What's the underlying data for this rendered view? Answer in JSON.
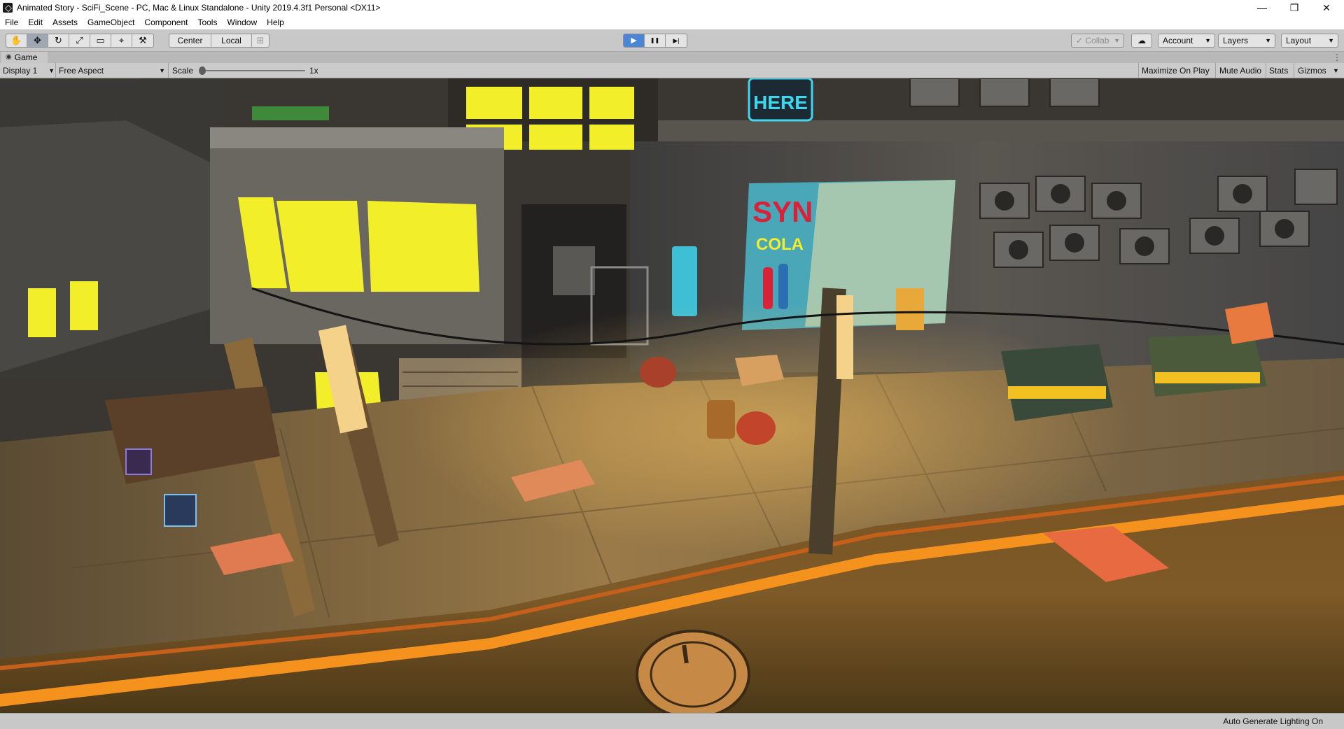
{
  "window": {
    "title": "Animated Story - SciFi_Scene - PC, Mac & Linux Standalone - Unity 2019.4.3f1 Personal <DX11>",
    "minimize_glyph": "—",
    "maximize_glyph": "❐",
    "close_glyph": "✕"
  },
  "menu": [
    "File",
    "Edit",
    "Assets",
    "GameObject",
    "Component",
    "Tools",
    "Window",
    "Help"
  ],
  "toolbar": {
    "transform_tools": [
      {
        "name": "hand-tool",
        "glyph": "✋"
      },
      {
        "name": "move-tool",
        "glyph": "✥"
      },
      {
        "name": "rotate-tool",
        "glyph": "↻"
      },
      {
        "name": "scale-tool",
        "glyph": "⤢"
      },
      {
        "name": "rect-tool",
        "glyph": "▭"
      },
      {
        "name": "transform-tool",
        "glyph": "⌖"
      },
      {
        "name": "custom-tool",
        "glyph": "⚒"
      }
    ],
    "pivot_label": "Center",
    "space_label": "Local",
    "snap_glyph": "⊞",
    "play_glyph": "▶",
    "pause_glyph": "❚❚",
    "step_glyph": "▶|",
    "collab_label": "Collab",
    "account_label": "Account",
    "layers_label": "Layers",
    "layout_label": "Layout",
    "cloud_glyph": "☁",
    "dropdown_glyph": "▼",
    "check_glyph": "✓"
  },
  "tab": {
    "label": "Game",
    "icon_glyph": "◉",
    "menu_glyph": "⋮"
  },
  "gamebar": {
    "display": "Display 1",
    "aspect": "Free Aspect",
    "scale_label": "Scale",
    "scale_value": "1x",
    "scale_level": 0.0,
    "maximize_on_play": "Maximize On Play",
    "mute_audio": "Mute Audio",
    "stats": "Stats",
    "gizmos": "Gizmos"
  },
  "scene": {
    "sign_here": "HERE",
    "poster_line1": "SYN",
    "poster_line2": "COLA",
    "accent_colors": {
      "window_yellow": "#f2ee2a",
      "street_orange": "#f5921e",
      "neon_cyan": "#3fd6f0",
      "poster_red": "#d8223a"
    }
  },
  "status": {
    "message": "Auto Generate Lighting On"
  }
}
